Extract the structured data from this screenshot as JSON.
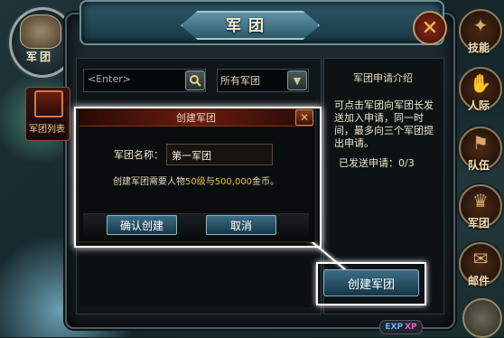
{
  "window": {
    "title": "军团",
    "close_icon": "close-x-icon",
    "emblem_label": "军团",
    "side_tab_label": "军团列表"
  },
  "search": {
    "placeholder": "<Enter>",
    "filter_selected": "所有军团"
  },
  "intro": {
    "title": "军团申请介绍",
    "text": "可点击军团向军团长发送加入申请，同一时间，最多向三个军团提出申请。",
    "sent_label": "已发送申请：",
    "sent_count": "0/3"
  },
  "create_button": "创建军团",
  "dialog": {
    "title": "创建军团",
    "name_label": "军团名称：",
    "name_value": "第一军团",
    "req_prefix": "创建军团需要人物",
    "req_level": "50级",
    "req_middle": "与",
    "req_gold": "500,000",
    "req_suffix": "金币。",
    "confirm_label": "确认创建",
    "cancel_label": "取消"
  },
  "menu": [
    {
      "label": "技能",
      "icon": "skill-icon"
    },
    {
      "label": "人际",
      "icon": "handshake-icon"
    },
    {
      "label": "队伍",
      "icon": "flag-icon"
    },
    {
      "label": "军团",
      "icon": "legion-icon"
    },
    {
      "label": "邮件",
      "icon": "mail-icon"
    }
  ],
  "exp": {
    "exp_label": "EXP",
    "xp_label": "XP"
  },
  "colors": {
    "accent_gold": "#f0c030",
    "button_blue": "#3a6d86",
    "dialog_red": "#6a1d0f"
  }
}
